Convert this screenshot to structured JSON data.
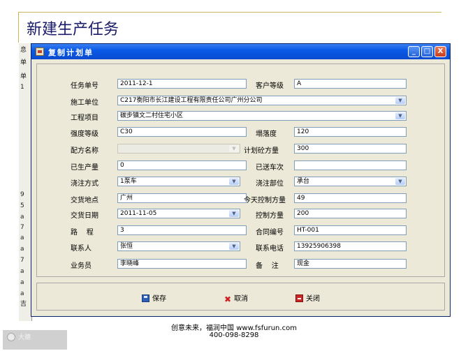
{
  "slide": {
    "title": "新建生产任务",
    "footer_line1": "创意未来，福润中国  www.fsfurun.com",
    "footer_line2": "400-098-8298"
  },
  "background_window": {
    "fragments": [
      "息",
      "单",
      "1",
      "9",
      "5",
      "a",
      "7",
      "a",
      "a",
      "7",
      "a",
      "a",
      "a",
      "a",
      "吉"
    ]
  },
  "watermark": {
    "text": "大德"
  },
  "window": {
    "title": "复制计划单",
    "minimize": "_",
    "maximize": "□",
    "close": "X"
  },
  "form": {
    "task_no": {
      "label": "任务单号",
      "value": "2011-12-1"
    },
    "customer_level": {
      "label": "客户等级",
      "value": "A"
    },
    "construction_unit": {
      "label": "施工单位",
      "value": "C217衡阳市长江建设工程有限责任公司广州分公司"
    },
    "project": {
      "label": "工程项目",
      "value": "碳步镇文二村住宅小区"
    },
    "strength_grade": {
      "label": "强度等级",
      "value": "C30"
    },
    "slump": {
      "label": "塌落度",
      "value": "120"
    },
    "mix_name": {
      "label": "配方名称",
      "value": ""
    },
    "plan_volume": {
      "label": "计划砼方量",
      "value": "300"
    },
    "produced": {
      "label": "已生产量",
      "value": "0"
    },
    "delivered_trips": {
      "label": "已送车次",
      "value": ""
    },
    "pour_method": {
      "label": "浇注方式",
      "value": "1泵车"
    },
    "pour_part": {
      "label": "浇注部位",
      "value": "承台"
    },
    "delivery_site": {
      "label": "交货地点",
      "value": "广州"
    },
    "today_control": {
      "label": "今天控制方量",
      "value": "49"
    },
    "delivery_date": {
      "label": "交货日期",
      "value": "2011-11-05"
    },
    "control_volume": {
      "label": "控制方量",
      "value": "200"
    },
    "distance": {
      "label": "路    程",
      "value": "3"
    },
    "contract_no": {
      "label": "合同编号",
      "value": "HT-001"
    },
    "contact": {
      "label": "联系人",
      "value": "张恒"
    },
    "contact_phone": {
      "label": "联系电话",
      "value": "13925906398"
    },
    "salesperson": {
      "label": "业务员",
      "value": "李晓峰"
    },
    "remarks": {
      "label": "备    注",
      "value": "现金"
    }
  },
  "actions": {
    "save": "保存",
    "cancel": "取消",
    "close": "关闭"
  },
  "icons": {
    "dropdown": "chevron-down-icon",
    "save": "floppy-disk-icon",
    "cancel": "red-x-icon",
    "close": "exit-door-icon"
  },
  "colors": {
    "titlebar": "#0b5ae6",
    "window_bg": "#ece9d8",
    "field_border": "#7f9db9",
    "slide_title": "#1a1a6a",
    "rule": "#c8b45a"
  }
}
